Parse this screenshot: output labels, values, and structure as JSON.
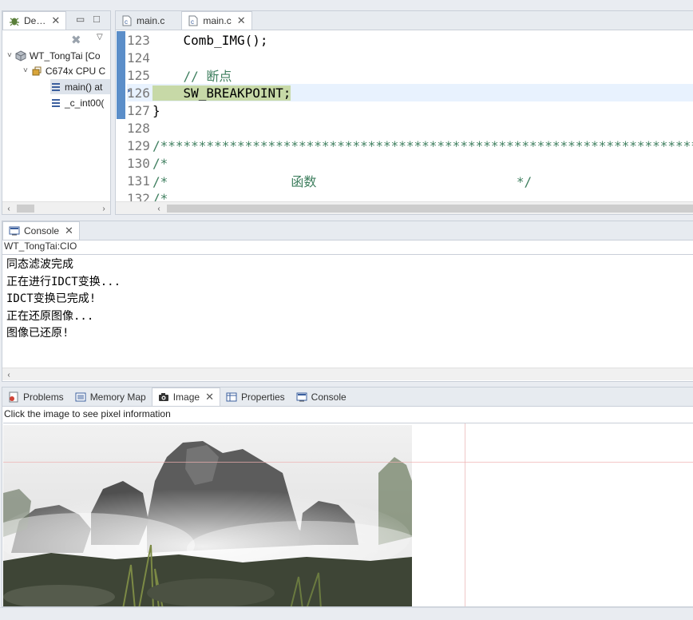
{
  "debug": {
    "tab_label": "De…",
    "tree": {
      "session": "WT_TongTai [Co",
      "cpu": "C674x CPU C",
      "frame_main": "main() at",
      "frame_cint": "_c_int00("
    }
  },
  "editor": {
    "tabs": [
      {
        "label": "main.c"
      },
      {
        "label": "main.c"
      }
    ],
    "lines": [
      {
        "num": "123",
        "text": "    Comb_IMG();"
      },
      {
        "num": "124",
        "text": ""
      },
      {
        "num": "125",
        "text": "    // 断点"
      },
      {
        "num": "126",
        "text": "    SW_BREAKPOINT;"
      },
      {
        "num": "127",
        "text": "}"
      },
      {
        "num": "128",
        "text": ""
      },
      {
        "num": "129",
        "text": "/**********************************************************************************"
      },
      {
        "num": "130",
        "text": "/*"
      },
      {
        "num": "131",
        "text": "/*                函数                          */"
      },
      {
        "num": "132",
        "text": "/*"
      }
    ]
  },
  "console": {
    "tab_label": "Console",
    "title": "WT_TongTai:CIO",
    "lines": [
      "同态滤波完成",
      "正在进行IDCT变换...",
      "IDCT变换已完成!",
      "正在还原图像...",
      "图像已还原!"
    ]
  },
  "bottom": {
    "tabs": {
      "problems": "Problems",
      "memory_map": "Memory Map",
      "image": "Image",
      "properties": "Properties",
      "console": "Console"
    },
    "hint": "Click the image to see pixel information"
  },
  "colors": {
    "accent": "#5b8ec9",
    "breakpoint_highlight": "#c7d9a7",
    "comment": "#3f7f5f"
  }
}
